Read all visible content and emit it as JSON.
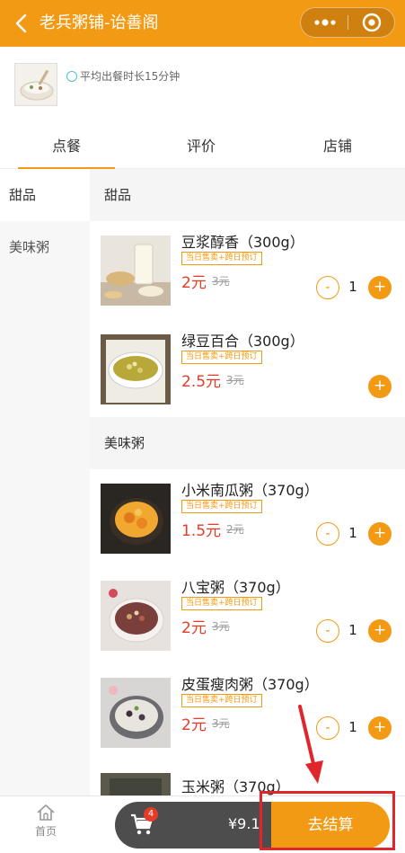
{
  "header": {
    "title": "老兵粥铺-诒善阁",
    "back_icon": "chevron-left-icon",
    "more_icon": "more-dots-icon",
    "close_icon": "target-icon",
    "bg_color": "#f39a14"
  },
  "shop": {
    "avg_time": "平均出餐时长15分钟"
  },
  "tabs": [
    {
      "label": "点餐"
    },
    {
      "label": "评价"
    },
    {
      "label": "店铺"
    }
  ],
  "sidebar": {
    "items": [
      {
        "label": "甜品"
      },
      {
        "label": "美味粥"
      }
    ]
  },
  "menu": {
    "sections": [
      {
        "title": "甜品",
        "items": [
          {
            "name": "豆浆醇香（300g）",
            "badge": "当日售卖+跨日预订",
            "price": "2元",
            "old_price": "3元",
            "qty": "1"
          },
          {
            "name": "绿豆百合（300g）",
            "badge": "当日售卖+跨日预订",
            "price": "2.5元",
            "old_price": "3元"
          }
        ]
      },
      {
        "title": "美味粥",
        "items": [
          {
            "name": "小米南瓜粥（370g）",
            "badge": "当日售卖+跨日预订",
            "price": "1.5元",
            "old_price": "2元",
            "qty": "1"
          },
          {
            "name": "八宝粥（370g）",
            "badge": "当日售卖+跨日预订",
            "price": "2元",
            "old_price": "3元",
            "qty": "1"
          },
          {
            "name": "皮蛋瘦肉粥（370g）",
            "badge": "当日售卖+跨日预订",
            "price": "2元",
            "old_price": "3元",
            "qty": "1"
          },
          {
            "name": "玉米粥（370g）"
          }
        ]
      }
    ]
  },
  "steppers": {
    "minus": "-",
    "plus": "+"
  },
  "bottom": {
    "home_label": "首页",
    "cart_count": "4",
    "total": "¥9.1",
    "checkout_label": "去结算"
  },
  "colors": {
    "accent": "#f39a14",
    "price": "#e63b26",
    "highlight": "#e0262a"
  }
}
